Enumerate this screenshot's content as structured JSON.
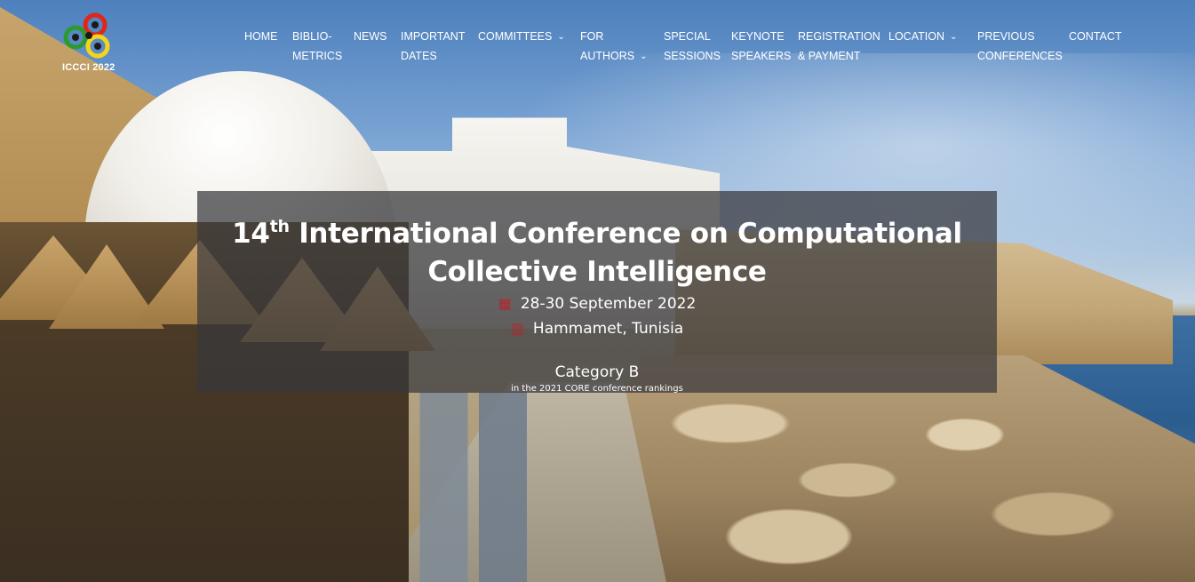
{
  "logo": {
    "text": "ICCCI 2022",
    "colors": [
      "#e0261b",
      "#2d9a2f",
      "#f4d51a",
      "#1a1a1a"
    ]
  },
  "nav": {
    "items": [
      {
        "lines": [
          "HOME"
        ]
      },
      {
        "lines": [
          "BIBLIO-",
          "METRICS"
        ]
      },
      {
        "lines": [
          "NEWS"
        ]
      },
      {
        "lines": [
          "IMPORTANT",
          "DATES"
        ]
      },
      {
        "lines": [
          "COMMITTEES"
        ],
        "dropdown": true
      },
      {
        "lines": [
          "FOR",
          "AUTHORS"
        ],
        "dropdown": true
      },
      {
        "lines": [
          "SPECIAL",
          "SESSIONS"
        ]
      },
      {
        "lines": [
          "KEYNOTE",
          "SPEAKERS"
        ]
      },
      {
        "lines": [
          "REGISTRATION",
          "& PAYMENT"
        ]
      },
      {
        "lines": [
          "LOCATION"
        ],
        "dropdown": true
      },
      {
        "lines": [
          "PREVIOUS",
          "CONFERENCES"
        ]
      },
      {
        "lines": [
          "CONTACT"
        ]
      }
    ],
    "chevron": "⌄"
  },
  "hero": {
    "title_ordinal": "14",
    "title_sup": "th",
    "title_rest_line1": " International Conference on Computational",
    "title_line2": "Collective Intelligence",
    "date_icon": "calendar-icon",
    "date": "28-30 September 2022",
    "location_icon": "map-icon",
    "location": "Hammamet, Tunisia",
    "category": "Category B",
    "ranking": "in the 2021 CORE conference rankings",
    "icon_color": "#b3282d"
  }
}
